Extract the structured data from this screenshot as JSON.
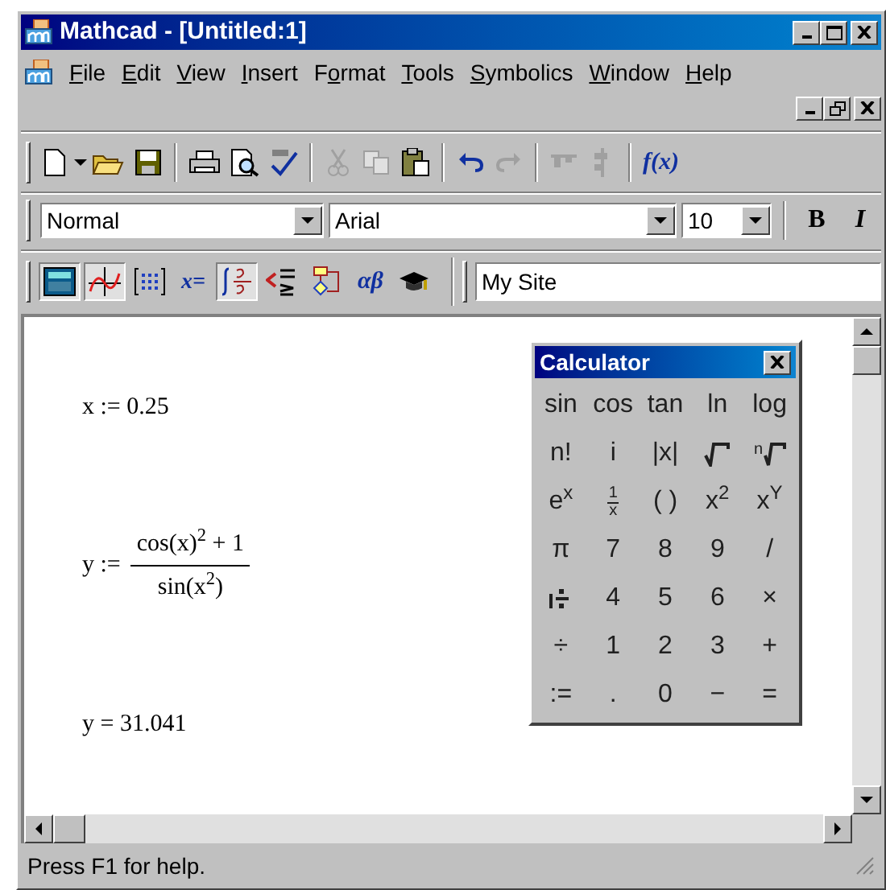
{
  "window": {
    "title": "Mathcad - [Untitled:1]"
  },
  "menu": [
    {
      "key": "F",
      "after": "ile"
    },
    {
      "key": "E",
      "after": "dit"
    },
    {
      "key": "V",
      "after": "iew"
    },
    {
      "key": "I",
      "after": "nsert"
    },
    {
      "before": "F",
      "key": "o",
      "after": "rmat"
    },
    {
      "key": "T",
      "after": "ools"
    },
    {
      "key": "S",
      "after": "ymbolics"
    },
    {
      "key": "W",
      "after": "indow"
    },
    {
      "key": "H",
      "after": "elp"
    }
  ],
  "standard_toolbar": {
    "function_label": "f(x)"
  },
  "format_toolbar": {
    "style": "Normal",
    "font": "Arial",
    "size": "10",
    "bold_label": "B",
    "italic_label": "I"
  },
  "math_toolbar": {
    "evaluation_label": "x=",
    "greek_label": "αβ",
    "pressed": [
      {
        "selected": true
      },
      {
        "selected": true
      },
      {
        "selected": false
      },
      {
        "selected": false
      },
      {
        "selected": true
      },
      {
        "selected": false
      },
      {
        "selected": false
      }
    ]
  },
  "resource_field": {
    "value": "My Site"
  },
  "worksheet": [
    {
      "kind": "assign",
      "lhs": "x",
      "op": ":=",
      "rhs": "0.25"
    },
    {
      "kind": "fraction",
      "lhs": "y",
      "op": ":=",
      "numerator": "cos(x)$^{2}$ + 1",
      "denominator": "sin(x$^{2}$)"
    },
    {
      "kind": "assign",
      "lhs": "y",
      "op": "=",
      "rhs": "31.041"
    }
  ],
  "calculator": {
    "title": "Calculator",
    "keys": [
      {
        "kind": "text",
        "label": "sin"
      },
      {
        "kind": "text",
        "label": "cos"
      },
      {
        "kind": "text",
        "label": "tan"
      },
      {
        "kind": "text",
        "label": "ln"
      },
      {
        "kind": "text",
        "label": "log"
      },
      {
        "kind": "text",
        "label": "n!"
      },
      {
        "kind": "text",
        "label": "i"
      },
      {
        "kind": "text",
        "label": "|x|"
      },
      {
        "kind": "root"
      },
      {
        "kind": "nroot",
        "label": "n"
      },
      {
        "kind": "text",
        "label": "e$^{x}$"
      },
      {
        "kind": "fraction",
        "numerator": "1",
        "denominator": "x"
      },
      {
        "kind": "text",
        "label": "( )"
      },
      {
        "kind": "text",
        "label": "x$^{2}$"
      },
      {
        "kind": "text",
        "label": "x$^{Y}$"
      },
      {
        "kind": "text",
        "label": "π"
      },
      {
        "kind": "text",
        "label": "7"
      },
      {
        "kind": "text",
        "label": "8"
      },
      {
        "kind": "text",
        "label": "9"
      },
      {
        "kind": "text",
        "label": "/"
      },
      {
        "kind": "mixed"
      },
      {
        "kind": "text",
        "label": "4"
      },
      {
        "kind": "text",
        "label": "5"
      },
      {
        "kind": "text",
        "label": "6"
      },
      {
        "kind": "text",
        "label": "×"
      },
      {
        "kind": "text",
        "label": "÷"
      },
      {
        "kind": "text",
        "label": "1"
      },
      {
        "kind": "text",
        "label": "2"
      },
      {
        "kind": "text",
        "label": "3"
      },
      {
        "kind": "text",
        "label": "+"
      },
      {
        "kind": "text",
        "label": ":="
      },
      {
        "kind": "text",
        "label": "."
      },
      {
        "kind": "text",
        "label": "0"
      },
      {
        "kind": "text",
        "label": "−"
      },
      {
        "kind": "text",
        "label": "="
      }
    ]
  },
  "status_bar": {
    "text": "Press F1 for help."
  }
}
